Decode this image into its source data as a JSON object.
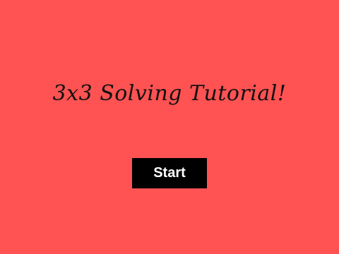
{
  "page": {
    "background_color": "#ff5252",
    "title": "3x3 Solving Tutorial!",
    "start_button_label": "Start"
  }
}
